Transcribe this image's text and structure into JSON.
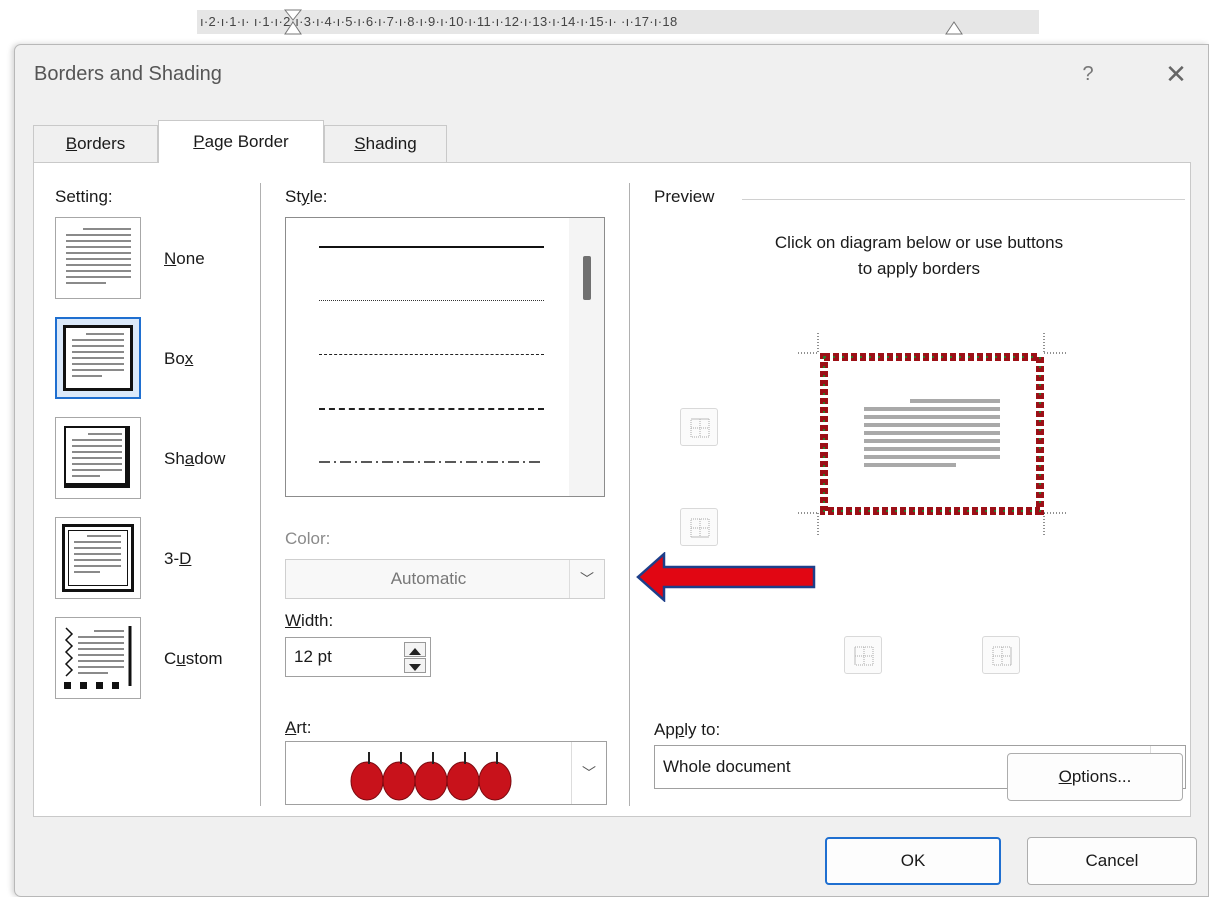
{
  "ruler": {
    "text": "ı·2·ı·1·ı·   ı·1·ı·2·ı·3·ı·4·ı·5·ı·6·ı·7·ı·8·ı·9·ı·10·ı·11·ı·12·ı·13·ı·14·ı·15·ı·   ·ı·17·ı·18"
  },
  "dialog": {
    "title": "Borders and Shading",
    "help": "?",
    "close": "✕"
  },
  "tabs": [
    {
      "label": "Borders",
      "accel": "B",
      "rest": "orders"
    },
    {
      "label": "Page Border",
      "accel": "P",
      "rest": "age Border"
    },
    {
      "label": "Shading",
      "accel": "S",
      "rest": "hading"
    }
  ],
  "setting": {
    "label": "Setting:",
    "options": [
      {
        "pre": "",
        "accel": "N",
        "post": "one"
      },
      {
        "pre": "Bo",
        "accel": "x",
        "post": ""
      },
      {
        "pre": "Sh",
        "accel": "a",
        "post": "dow"
      },
      {
        "pre": "3-",
        "accel": "D",
        "post": ""
      },
      {
        "pre": "C",
        "accel": "u",
        "post": "stom"
      }
    ]
  },
  "style": {
    "pre": "St",
    "accel": "y",
    "post": "le:"
  },
  "color": {
    "label": "Color:",
    "value": "Automatic"
  },
  "width": {
    "accel": "W",
    "post": "idth:",
    "value": "12 pt"
  },
  "art": {
    "pre": "",
    "accel": "A",
    "post": "rt:"
  },
  "preview": {
    "label": "Preview",
    "instruction_line1": "Click on diagram below or use buttons",
    "instruction_line2": "to apply borders"
  },
  "apply_to": {
    "pre": "Ap",
    "accel": "p",
    "post": "ly to:",
    "value": "Whole document"
  },
  "buttons": {
    "options_accel": "O",
    "options_rest": "ptions...",
    "ok": "OK",
    "cancel": "Cancel"
  },
  "colors": {
    "accent": "#1f6fd0",
    "arrow_fill": "#e10613",
    "arrow_outline": "#1d3f8a",
    "apple": "#c8121b"
  }
}
